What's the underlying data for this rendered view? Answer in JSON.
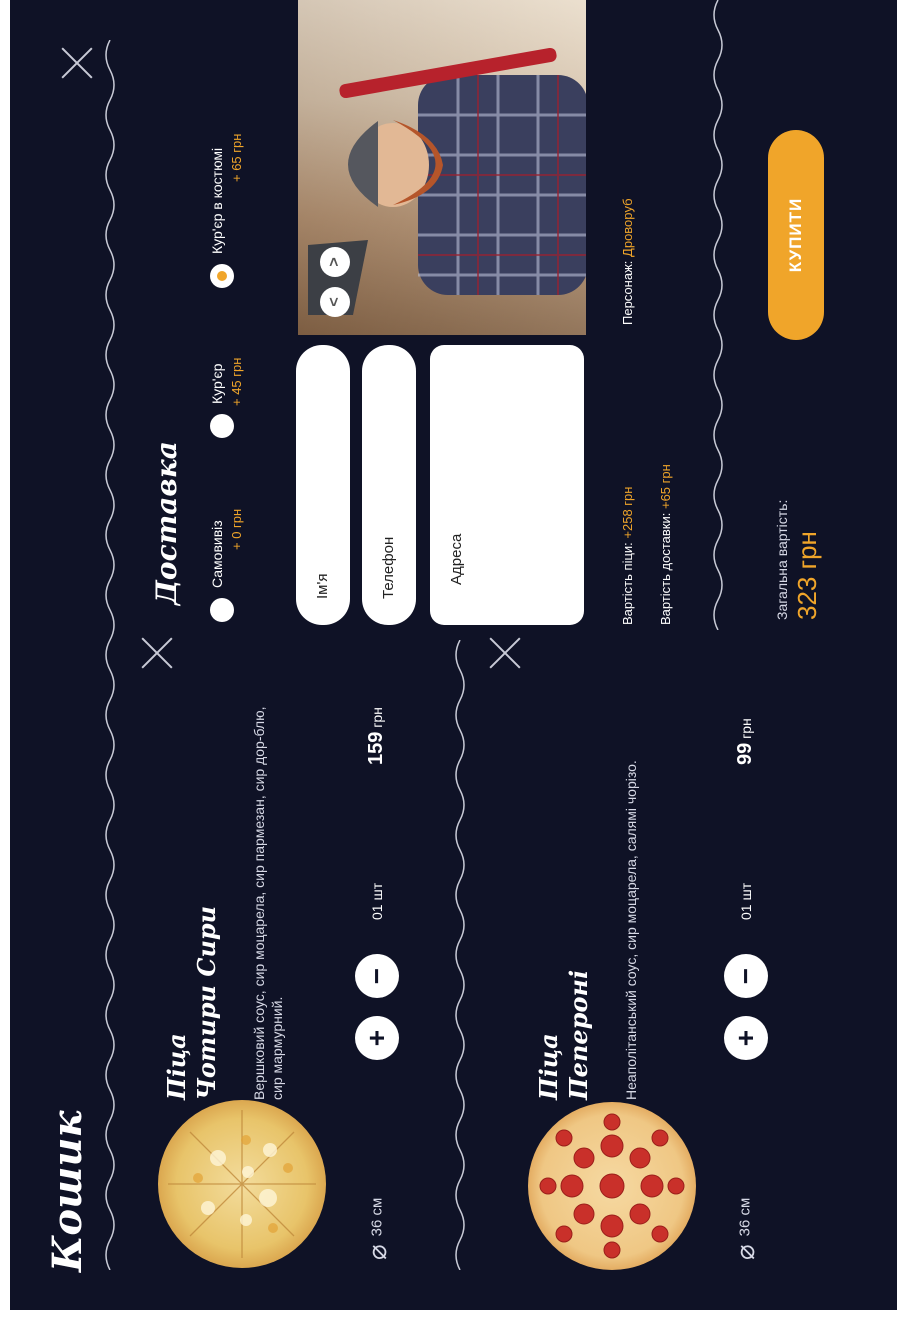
{
  "cart": {
    "title": "Кошик",
    "items": [
      {
        "name_line1": "Піца",
        "name_line2": "Чотири Сири",
        "description": "Вершковий соус, сир моцарела, сир пармезан, сир дор-блю, сир мармурний.",
        "size": "36 см",
        "quantity": "01 шт",
        "price": "159",
        "currency": "грн",
        "plus": "+",
        "minus": "−"
      },
      {
        "name_line1": "Піца",
        "name_line2": "Пепероні",
        "description": "Неаполітанський соус, сир моцарела, салямі чорізо.",
        "size": "36 см",
        "quantity": "01 шт",
        "price": "99",
        "currency": "грн",
        "plus": "+",
        "minus": "−"
      }
    ]
  },
  "delivery": {
    "title": "Доставка",
    "options": [
      {
        "label": "Самовивіз",
        "price": "+ 0 грн",
        "selected": false
      },
      {
        "label": "Кур'єр",
        "price": "+ 45 грн",
        "selected": false
      },
      {
        "label": "Кур'єр в костюмі",
        "price": "+ 65 грн",
        "selected": true
      }
    ],
    "name_placeholder": "Ім'я",
    "phone_placeholder": "Телефон",
    "address_placeholder": "Адреса",
    "character_label": "Персонаж:",
    "character_name": "Дровоpуб",
    "prev": "<",
    "next": ">"
  },
  "summary": {
    "pizza_cost_label": "Вартість піци:",
    "pizza_cost_value": "+258 грн",
    "delivery_cost_label": "Вартість доставки:",
    "delivery_cost_value": "+65 грн",
    "total_label": "Загальна вартість:",
    "total_value": "323 грн",
    "buy_label": "КУПИТИ"
  },
  "colors": {
    "background": "#0f1226",
    "accent": "#f0a52a",
    "text": "#ffffff"
  }
}
